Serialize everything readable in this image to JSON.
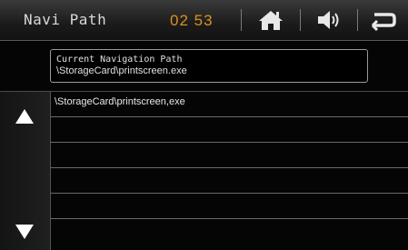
{
  "header": {
    "title": "Navi Path",
    "time": "02 53",
    "icons": [
      "home-icon",
      "volume-icon",
      "back-icon"
    ]
  },
  "current_path": {
    "label": "Current Navigation Path",
    "value": "\\StorageCard\\printscreen.exe"
  },
  "file_list": {
    "items": [
      "\\StorageCard\\printscreen,exe",
      "",
      "",
      "",
      "",
      ""
    ]
  },
  "colors": {
    "time_accent": "#d8921f",
    "background": "#050505"
  }
}
